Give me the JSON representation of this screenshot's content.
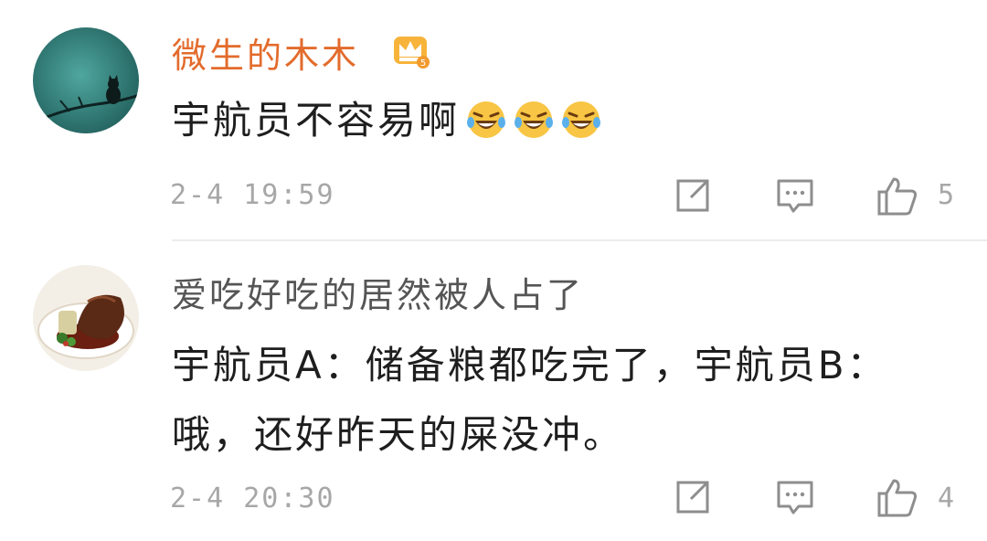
{
  "comments": [
    {
      "username": "微生的木木",
      "username_color": "#e36b2c",
      "badge": "vip-crown-badge",
      "text": "宇航员不容易啊",
      "emojis": [
        "laughing-tears-emoji",
        "laughing-tears-emoji",
        "laughing-tears-emoji"
      ],
      "time": "2-4 19:59",
      "likes": "5"
    },
    {
      "username": "爱吃好吃的居然被人占了",
      "username_color": "#555555",
      "text": "宇航员A：储备粮都吃完了，宇航员B：哦，还好昨天的屎没冲。",
      "time": "2-4 20:30",
      "likes": "4"
    }
  ],
  "icons": {
    "share": "share-icon",
    "reply": "reply-icon",
    "like": "thumbs-up-icon"
  },
  "colors": {
    "text": "#1e1e1e",
    "muted": "#a7a7a7",
    "divider": "#ececec",
    "vip_orange": "#e36b2c"
  }
}
